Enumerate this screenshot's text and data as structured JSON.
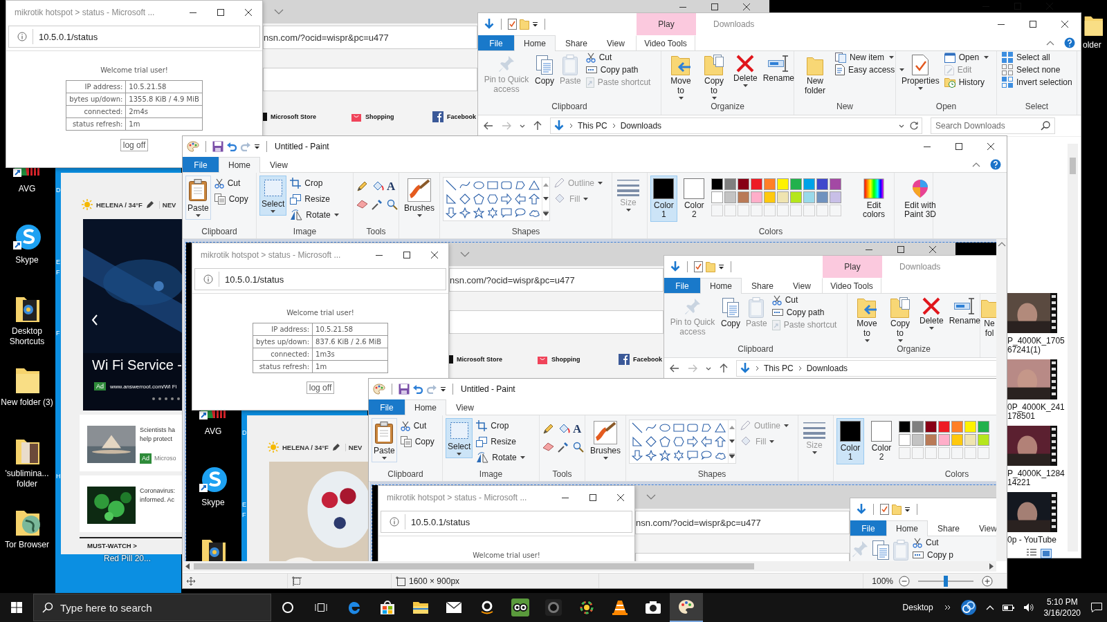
{
  "screen": {
    "desktop_icons": [
      {
        "kind": "avg",
        "label": "AVG"
      },
      {
        "kind": "skype",
        "label": "Skype"
      },
      {
        "kind": "folder",
        "label": "Desktop Shortcuts"
      },
      {
        "kind": "folder",
        "label": "New folder (3)"
      },
      {
        "kind": "folder",
        "label": "'sublimina... folder"
      },
      {
        "kind": "folder",
        "label": "Tor Browser"
      }
    ],
    "label_fragments": [
      "D",
      "E",
      "F",
      "F",
      "H"
    ],
    "desktop_icons_right": [
      {
        "label": "older"
      }
    ],
    "msn_page": {
      "weather": "HELENA / 34°F",
      "nav": "NEV",
      "carousel": {
        "kind": "picture",
        "headline": "Wi Fi Service -",
        "badge": "Ad",
        "source": "www.answerroot.com/Wi Fi",
        "dots": [
          {
            "selected": false
          },
          {
            "selected": false
          },
          {
            "selected": false
          },
          {
            "selected": false
          },
          {
            "selected": false
          }
        ]
      },
      "stories": [
        {
          "lines": [
            "Scientists ha",
            "help protect"
          ],
          "badge": "Ad",
          "source": "Microso"
        },
        {
          "lines": [
            "Coronavirus:",
            "informed. Ac"
          ]
        }
      ],
      "section": "MUST-WATCH >"
    },
    "desktop_icon_bottom": {
      "label": "Red Pill 20..."
    },
    "msn_browser": {
      "controls": true,
      "url": "nsn.com/?ocid=wispr&pc=u477",
      "links": [
        {
          "label": "Microsoft Store"
        },
        {
          "label": "Shopping"
        },
        {
          "label": "Facebook"
        }
      ]
    },
    "dark_window": {
      "controls": true
    },
    "explorer": {
      "contextual_tab": "Play",
      "title": "Downloads",
      "controls": true,
      "tabs": [
        {
          "label": "File",
          "kind": "file",
          "selected": false
        },
        {
          "label": "Home",
          "kind": "tab",
          "selected": true
        },
        {
          "label": "Share",
          "kind": "tab",
          "selected": false
        },
        {
          "label": "View",
          "kind": "tab",
          "selected": false
        },
        {
          "label": "Video Tools",
          "kind": "context",
          "selected": false
        }
      ],
      "ribbon": [
        {
          "label": "Clipboard",
          "items": [
            {
              "label": "Pin to Quick access",
              "disabled": true,
              "menu": false
            },
            {
              "label": "Copy",
              "disabled": false,
              "menu": false
            },
            {
              "label": "Paste",
              "disabled": true,
              "menu": false
            },
            {
              "label": "Cut",
              "disabled": false,
              "menu": false
            },
            {
              "label": "Copy path",
              "disabled": false,
              "menu": false
            },
            {
              "label": "Paste shortcut",
              "disabled": true,
              "menu": false
            }
          ]
        },
        {
          "label": "Organize",
          "items": [
            {
              "label": "Move to",
              "disabled": false,
              "menu": true
            },
            {
              "label": "Copy to",
              "disabled": false,
              "menu": true
            },
            {
              "label": "Delete",
              "disabled": false,
              "menu": true
            },
            {
              "label": "Rename",
              "disabled": false,
              "menu": false
            }
          ]
        },
        {
          "label": "New",
          "items": [
            {
              "label": "New folder",
              "disabled": false,
              "menu": false
            },
            {
              "label": "New item",
              "disabled": false,
              "menu": true
            },
            {
              "label": "Easy access",
              "disabled": false,
              "menu": true
            }
          ]
        },
        {
          "label": "Open",
          "items": [
            {
              "label": "Properties",
              "disabled": false,
              "menu": true
            },
            {
              "label": "Open",
              "disabled": false,
              "menu": true
            },
            {
              "label": "Edit",
              "disabled": true,
              "menu": false
            },
            {
              "label": "History",
              "disabled": false,
              "menu": false
            }
          ]
        },
        {
          "label": "Select",
          "items": [
            {
              "label": "Select all",
              "disabled": false,
              "menu": false
            },
            {
              "label": "Select none",
              "disabled": false,
              "menu": false
            },
            {
              "label": "Invert selection",
              "disabled": false,
              "menu": false
            }
          ]
        }
      ],
      "address": {
        "path": [
          "This PC",
          "Downloads"
        ]
      },
      "search": {
        "placeholder": "Search Downloads"
      },
      "files": [
        {
          "name_lines": [
            "P_4000K_1705",
            "67241(1)"
          ]
        },
        {
          "name_lines": [
            "0P_4000K_241",
            "178501"
          ]
        },
        {
          "name_lines": [
            "P_4000K_1284",
            "14221"
          ]
        },
        {
          "name_lines": [
            "0p - YouTube"
          ]
        }
      ]
    },
    "paint": {
      "title": "Untitled - Paint",
      "controls": true,
      "tabs": [
        {
          "label": "File",
          "kind": "file",
          "selected": false
        },
        {
          "label": "Home",
          "kind": "tab",
          "selected": true
        },
        {
          "label": "View",
          "kind": "tab",
          "selected": false
        }
      ],
      "clipboard": {
        "paste": "Paste",
        "cut": "Cut",
        "copy": "Copy",
        "label": "Clipboard"
      },
      "image": {
        "select": {
          "label": "Select",
          "selected": true
        },
        "crop": "Crop",
        "resize": "Resize",
        "rotate": "Rotate",
        "label": "Image"
      },
      "tools": {
        "text_tool": "A",
        "label": "Tools"
      },
      "brushes": {
        "label": "Brushes"
      },
      "shapes": {
        "outline": {
          "label": "Outline",
          "disabled": true
        },
        "fill": {
          "label": "Fill",
          "disabled": true
        },
        "label": "Shapes"
      },
      "size": {
        "label": "Size",
        "disabled": true
      },
      "colors": {
        "color1": {
          "label": "Color 1",
          "color": "#000000",
          "selected": true
        },
        "color2": {
          "label": "Color 2",
          "color": "#ffffff",
          "selected": false
        },
        "palette_rows": [
          [
            {
              "color": "#000000"
            },
            {
              "color": "#7f7f7f"
            },
            {
              "color": "#880015"
            },
            {
              "color": "#ed1c24"
            },
            {
              "color": "#ff7f27"
            },
            {
              "color": "#fff200"
            },
            {
              "color": "#22b14c"
            },
            {
              "color": "#00a2e8"
            },
            {
              "color": "#3f48cc"
            },
            {
              "color": "#a349a4"
            }
          ],
          [
            {
              "color": "#ffffff"
            },
            {
              "color": "#c3c3c3"
            },
            {
              "color": "#b97a57"
            },
            {
              "color": "#ffaec9"
            },
            {
              "color": "#ffc90e"
            },
            {
              "color": "#efe4b0"
            },
            {
              "color": "#b5e61d"
            },
            {
              "color": "#99d9ea"
            },
            {
              "color": "#7092be"
            },
            {
              "color": "#c8bfe7"
            }
          ]
        ],
        "custom_slots": [
          {
            "filled": false
          },
          {
            "filled": false
          },
          {
            "filled": false
          },
          {
            "filled": false
          },
          {
            "filled": false
          },
          {
            "filled": false
          },
          {
            "filled": false
          },
          {
            "filled": false
          },
          {
            "filled": false
          },
          {
            "filled": false
          }
        ],
        "edit": "Edit colors",
        "label": "Colors"
      },
      "paint3d": "Edit with Paint 3D",
      "status": {
        "size": "1600 × 900px",
        "zoom": "100%",
        "zoom_slider": {
          "level": 0.5
        }
      },
      "canvas": {
        "desktop_icons": [
          {
            "kind": "avg",
            "label": "AVG"
          },
          {
            "kind": "skype",
            "label": "Skype"
          },
          {
            "kind": "folder"
          }
        ],
        "label_fragments": [
          "D",
          "E",
          "F"
        ],
        "msn_page": {
          "weather": "HELENA / 34°F",
          "nav": "NEV"
        },
        "msn_browser": {
          "controls": true,
          "url": "nsn.com/?ocid=wispr&pc=u477",
          "links": [
            {
              "label": "Microsoft Store"
            },
            {
              "label": "Shopping"
            },
            {
              "label": "Facebook"
            }
          ]
        },
        "explorer": {
          "contextual_tab": "Play",
          "title": "Downloads",
          "controls": false,
          "tabs": [
            {
              "label": "File",
              "kind": "file",
              "selected": false
            },
            {
              "label": "Home",
              "kind": "tab",
              "selected": true
            },
            {
              "label": "Share",
              "kind": "tab",
              "selected": false
            },
            {
              "label": "View",
              "kind": "tab",
              "selected": false
            },
            {
              "label": "Video Tools",
              "kind": "context",
              "selected": false
            }
          ],
          "ribbon": [
            {
              "label": "Clipboard",
              "items": [
                {
                  "label": "Pin to Quick access",
                  "disabled": true,
                  "menu": false
                },
                {
                  "label": "Copy",
                  "disabled": false,
                  "menu": false
                },
                {
                  "label": "Paste",
                  "disabled": true,
                  "menu": false
                },
                {
                  "label": "Cut",
                  "disabled": false,
                  "menu": false
                },
                {
                  "label": "Copy path",
                  "disabled": false,
                  "menu": false
                },
                {
                  "label": "Paste shortcut",
                  "disabled": true,
                  "menu": false
                }
              ]
            },
            {
              "label": "Organize",
              "items": [
                {
                  "label": "Move to",
                  "disabled": false,
                  "menu": true
                },
                {
                  "label": "Copy to",
                  "disabled": false,
                  "menu": true
                },
                {
                  "label": "Delete",
                  "disabled": false,
                  "menu": true
                },
                {
                  "label": "Rename",
                  "disabled": false,
                  "menu": false
                }
              ]
            },
            {
              "items": [
                {
                  "label": "Ne fol",
                  "disabled": false,
                  "menu": false
                }
              ]
            }
          ],
          "address": {
            "path": [
              "This PC",
              "Downloads"
            ]
          }
        },
        "paint": {
          "title": "Untitled - Paint",
          "controls": false,
          "tabs": [
            {
              "label": "File",
              "kind": "file",
              "selected": false
            },
            {
              "label": "Home",
              "kind": "tab",
              "selected": true
            },
            {
              "label": "View",
              "kind": "tab",
              "selected": false
            }
          ],
          "clipboard": {
            "paste": "Paste",
            "cut": "Cut",
            "copy": "Copy",
            "label": "Clipboard"
          },
          "image": {
            "select": {
              "label": "Select",
              "selected": true
            },
            "crop": "Crop",
            "resize": "Resize",
            "rotate": "Rotate",
            "label": "Image"
          },
          "tools": {
            "text_tool": "A",
            "label": "Tools"
          },
          "brushes": {
            "label": "Brushes"
          },
          "shapes": {
            "outline": {
              "label": "Outline",
              "disabled": true
            },
            "fill": {
              "label": "Fill",
              "disabled": true
            },
            "label": "Shapes"
          },
          "size": {
            "label": "Size",
            "disabled": true
          },
          "colors": {
            "color1": {
              "label": "Color 1",
              "color": "#000000",
              "selected": true
            },
            "color2": {
              "label": "Color 2",
              "color": "#ffffff",
              "selected": false
            },
            "palette_rows": [
              [
                {
                  "color": "#000000"
                },
                {
                  "color": "#7f7f7f"
                },
                {
                  "color": "#880015"
                },
                {
                  "color": "#ed1c24"
                },
                {
                  "color": "#ff7f27"
                },
                {
                  "color": "#fff200"
                },
                {
                  "color": "#22b14c"
                }
              ],
              [
                {
                  "color": "#ffffff"
                },
                {
                  "color": "#c3c3c3"
                },
                {
                  "color": "#b97a57"
                },
                {
                  "color": "#ffaec9"
                },
                {
                  "color": "#ffc90e"
                },
                {
                  "color": "#efe4b0"
                },
                {
                  "color": "#b5e61d"
                }
              ]
            ],
            "custom_slots": [
              {
                "filled": false
              },
              {
                "filled": false
              },
              {
                "filled": false
              },
              {
                "filled": false
              },
              {
                "filled": false
              },
              {
                "filled": false
              },
              {
                "filled": false
              }
            ],
            "label": "Colors"
          },
          "canvas": {
            "msn_browser": {
              "controls": false,
              "url": "nsn.com/?ocid=wispr&pc=u477"
            },
            "explorer": {
              "controls": false,
              "tabs": [
                {
                  "label": "File",
                  "kind": "file",
                  "selected": false
                },
                {
                  "label": "Home",
                  "kind": "tab",
                  "selected": true
                },
                {
                  "label": "Share",
                  "kind": "tab",
                  "selected": false
                },
                {
                  "label": "View",
                  "kind": "tab",
                  "selected": false
                }
              ],
              "ribbon": [
                {
                  "items": [
                    {
                      "disabled": true,
                      "menu": false
                    },
                    {
                      "disabled": false,
                      "menu": false
                    },
                    {
                      "disabled": true,
                      "menu": false
                    },
                    {
                      "label": "Cut",
                      "disabled": false,
                      "menu": false
                    },
                    {
                      "label": "Copy p",
                      "disabled": false,
                      "menu": false
                    }
                  ]
                }
              ]
            },
            "hotspot": {
              "title": "mikrotik hotspot > status - Microsoft ...",
              "controls": true,
              "url": "10.5.0.1/status",
              "welcome": "Welcome trial user!"
            }
          }
        },
        "hotspot": {
          "title": "mikrotik hotspot > status - Microsoft ...",
          "controls": true,
          "url": "10.5.0.1/status",
          "welcome": "Welcome trial user!",
          "rows": [
            {
              "label": "IP address:",
              "value": "10.5.21.58"
            },
            {
              "label": "bytes up/down:",
              "value": "837.6 KiB / 2.6 MiB"
            },
            {
              "label": "connected:",
              "value": "1m3s"
            },
            {
              "label": "status refresh:",
              "value": "1m"
            }
          ],
          "button": "log off"
        }
      }
    },
    "hotspot": {
      "title": "mikrotik hotspot > status - Microsoft ...",
      "controls": true,
      "url": "10.5.0.1/status",
      "welcome": "Welcome trial user!",
      "rows": [
        {
          "label": "IP address:",
          "value": "10.5.21.58"
        },
        {
          "label": "bytes up/down:",
          "value": "1355.8 KiB / 4.9 MiB"
        },
        {
          "label": "connected:",
          "value": "2m4s"
        },
        {
          "label": "status refresh:",
          "value": "1m"
        }
      ],
      "button": "log off"
    },
    "taskbar": {
      "search": {
        "placeholder": "Type here to search"
      },
      "apps": [
        {
          "active": false
        },
        {
          "active": false
        },
        {
          "active": false
        },
        {
          "active": false
        },
        {
          "active": false
        },
        {
          "active": false
        },
        {
          "active": false
        },
        {
          "active": false
        },
        {
          "active": false
        },
        {
          "active": false
        },
        {
          "active": false
        },
        {
          "active": false
        },
        {
          "active": true
        }
      ],
      "toolbar": "Desktop",
      "time": "5:10 PM",
      "date": "3/16/2020"
    }
  }
}
